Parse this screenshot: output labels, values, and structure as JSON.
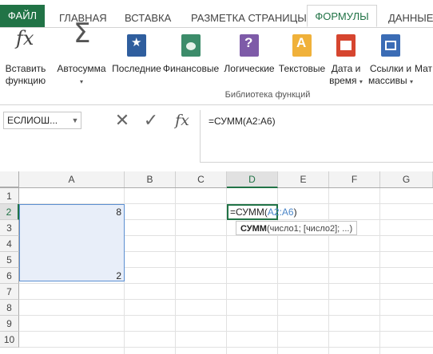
{
  "ribbon_tabs": [
    "ФАЙЛ",
    "ГЛАВНАЯ",
    "ВСТАВКА",
    "РАЗМЕТКА СТРАНИЦЫ",
    "ФОРМУЛЫ",
    "ДАННЫЕ"
  ],
  "ribbon": {
    "insert_function": [
      "Вставить",
      "функцию"
    ],
    "autosum": "Автосумма",
    "recent": "Последние",
    "financial": "Финансовые",
    "logical": "Логические",
    "text": "Текстовые",
    "datetime": [
      "Дата и",
      "время"
    ],
    "lookup": [
      "Ссылки и",
      "массивы"
    ],
    "math_partial": "Мат",
    "group_label": "Библиотека функций",
    "colors": {
      "autosum": "#555555",
      "recent": "#2f5e9e",
      "financial": "#3c8c6a",
      "logical": "#7e5ba8",
      "text": "#f0b13a",
      "datetime": "#d6452f",
      "lookup": "#3b6cb5"
    }
  },
  "formula_bar": {
    "name_box": "ЕСЛИОШ...",
    "fx": "fx",
    "content": "=СУММ(A2:A6)"
  },
  "grid": {
    "columns": [
      "A",
      "B",
      "C",
      "D",
      "E",
      "F",
      "G"
    ],
    "rows": [
      "1",
      "2",
      "3",
      "4",
      "5",
      "6",
      "7",
      "8",
      "9",
      "10"
    ],
    "cells": {
      "A2": "8",
      "A6": "2"
    },
    "edit_cell": {
      "prefix": "=СУММ(",
      "ref": "A2:A6",
      "suffix": ")"
    },
    "tooltip": {
      "func": "СУММ",
      "args": "(число1; [число2]; ...)"
    }
  },
  "accent": "#217346"
}
